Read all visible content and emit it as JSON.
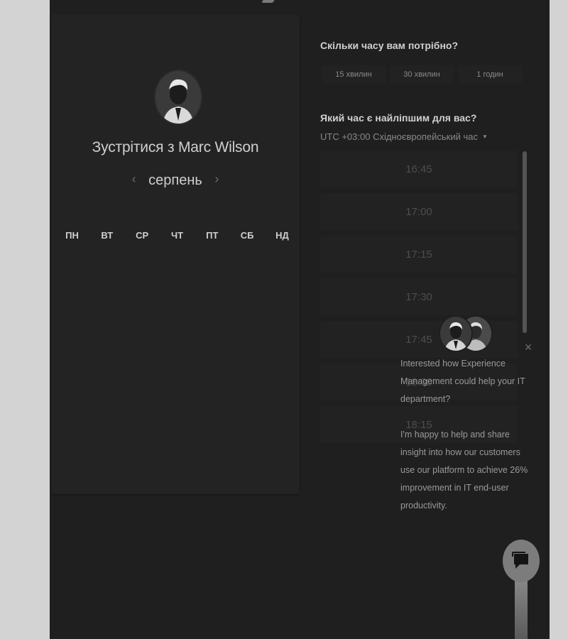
{
  "organizer_title": "Зустрітися з Marc Wilson",
  "calendar": {
    "month": "серпень",
    "weekdays": [
      "ПН",
      "ВТ",
      "СР",
      "ЧТ",
      "ПТ",
      "СБ",
      "НД"
    ]
  },
  "duration": {
    "question": "Скільки часу вам потрібно?",
    "options": [
      "15 хвилин",
      "30 хвилин",
      "1 годин"
    ]
  },
  "time": {
    "question": "Який час є найліпшим для вас?",
    "timezone": "UTC +03:00 Східноєвропейський час",
    "slots": [
      "16:45",
      "17:00",
      "17:15",
      "17:30",
      "17:45",
      "18:00",
      "18:15"
    ]
  },
  "chat": {
    "message_1": "Interested how Experience Management could help your IT department?",
    "message_2": "I'm happy to help and share insight into how our customers use our platform to achieve 26% improvement in IT end-user productivity."
  },
  "icons": {
    "prev": "chevron-left-icon",
    "next": "chevron-right-icon",
    "caret": "caret-down-icon",
    "close": "close-icon",
    "chat": "chat-bubble-icon"
  },
  "colors": {
    "background": "#1f1f1f",
    "card": "#232323",
    "text": "#cfcfcf",
    "muted": "#8a8a8a",
    "launcher": "#7c7c7c"
  }
}
